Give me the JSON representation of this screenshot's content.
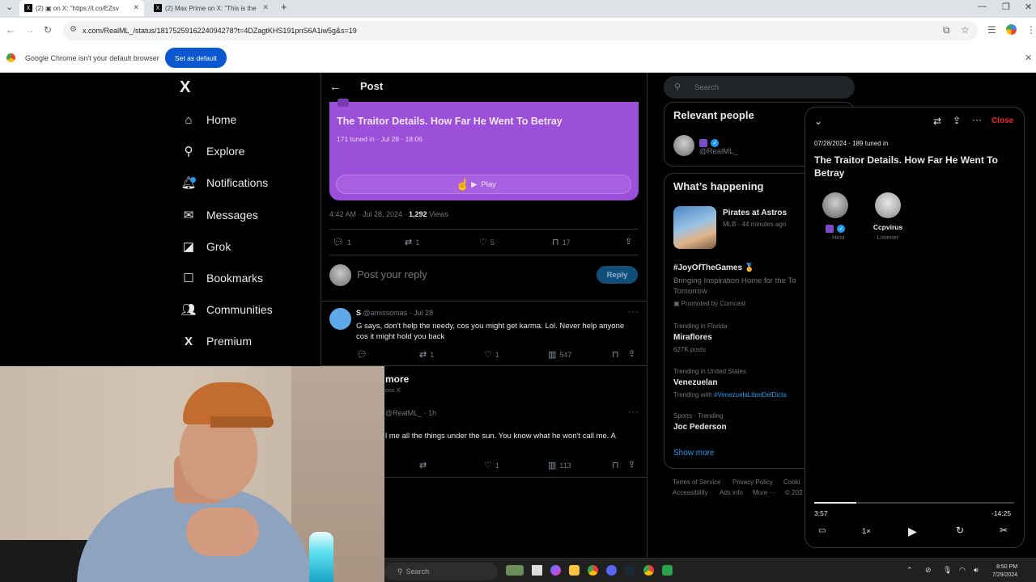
{
  "browser": {
    "tabs": [
      {
        "label": "(2) ▣ on X: \"https://t.co/EZsv",
        "active": true
      },
      {
        "label": "(2) Max Prime on X: \"This is the",
        "active": false
      }
    ],
    "new_tab": "+",
    "url": "x.com/RealML_/status/1817525916224094278?t=4DZagtKHS191pnS6A1iw5g&s=19",
    "infobar_message": "Google Chrome isn't your default browser",
    "set_default_label": "Set as default"
  },
  "sidebar": {
    "logo": "X",
    "items": [
      {
        "label": "Home",
        "icon": "home-icon",
        "glyph": "⌂"
      },
      {
        "label": "Explore",
        "icon": "search-icon",
        "glyph": "⚲"
      },
      {
        "label": "Notifications",
        "icon": "bell-icon",
        "glyph": "🔔︎"
      },
      {
        "label": "Messages",
        "icon": "mail-icon",
        "glyph": "✉"
      },
      {
        "label": "Grok",
        "icon": "grok-icon",
        "glyph": "◪"
      },
      {
        "label": "Bookmarks",
        "icon": "bookmark-icon",
        "glyph": "☐"
      },
      {
        "label": "Communities",
        "icon": "communities-icon",
        "glyph": "👥︎"
      },
      {
        "label": "Premium",
        "icon": "x-premium-icon",
        "glyph": "X"
      }
    ]
  },
  "post": {
    "header_title": "Post",
    "space_card": {
      "title": "The Traitor Details. How Far He Went To Betray",
      "meta": "171 tuned in · Jul 28 · 18:06",
      "play_label": "Play"
    },
    "timestamp": "4:42 AM · Jul 28, 2024 · ",
    "views_count": "1,292",
    "views_label": " Views",
    "actions": {
      "replies": "1",
      "reposts": "1",
      "likes": "5",
      "bookmarks": "17"
    },
    "reply_placeholder": "Post your reply",
    "reply_button": "Reply"
  },
  "replies": [
    {
      "name": "S",
      "handle": "@amissomas · Jul 28",
      "text": "G says, don't help the needy, cos you might get karma. Lol. Never help anyone cos it might hold you back",
      "replies": "",
      "reposts": "1",
      "likes": "1",
      "views": "547"
    },
    {
      "heading": "more",
      "sub": "oss X",
      "handle": "@RealML_ · 1h",
      "text": "l me all the things under the sun. You know what he won't call me. A",
      "likes": "1",
      "views": "113"
    }
  ],
  "right": {
    "search_placeholder": "Search",
    "relevant_title": "Relevant people",
    "relevant_handle": "@RealML_",
    "happening_title": "What’s happening",
    "trends": [
      {
        "title": "Pirates at Astros",
        "meta": "MLB · 44 minutes ago"
      },
      {
        "title": "#JoyOfTheGames 🏅",
        "desc": "Bringing Inspiration Home for the To Tomorrow",
        "promo": "Promoted by Comcast"
      },
      {
        "context": "Trending in Florida",
        "title": "Miraflores",
        "count": "627K posts"
      },
      {
        "context": "Trending in United States",
        "title": "Venezuelan",
        "with_prefix": "Trending with ",
        "with_tag": "#VenezuelaLibreDelDicta"
      },
      {
        "context": "Sports · Trending",
        "title": "Joc Pederson"
      }
    ],
    "show_more": "Show more",
    "footer": [
      "Terms of Service",
      "Privacy Policy",
      "Cooki",
      "Accessibility",
      "Ads info",
      "More ···",
      "© 202"
    ]
  },
  "space_panel": {
    "close_label": "Close",
    "meta": "07/28/2024 · 189 tuned in",
    "title": "The Traitor Details. How Far He Went To Betray",
    "participants": [
      {
        "name": "",
        "role": "···Host"
      },
      {
        "name": "Ccpvirus",
        "role": "Listener"
      }
    ],
    "elapsed": "3:57",
    "remaining": "-14:25",
    "progress": 0.21,
    "speed": "1×"
  },
  "taskbar": {
    "search_placeholder": "Search",
    "time": "8:50 PM",
    "date": "7/29/2024"
  },
  "colors": {
    "space_purple": "#9c4fd8",
    "link_blue": "#1d9bf0",
    "close_red": "#f4212e",
    "chrome_blue": "#0b57d0"
  }
}
